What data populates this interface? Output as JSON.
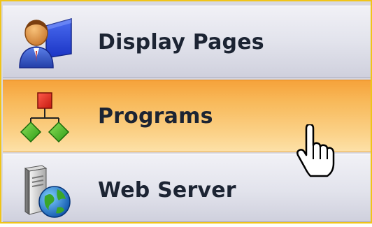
{
  "nav": {
    "items": [
      {
        "label": "Display Pages",
        "icon": "user-display-icon",
        "state": "normal"
      },
      {
        "label": "Programs",
        "icon": "program-tree-icon",
        "state": "hover"
      },
      {
        "label": "Web Server",
        "icon": "web-server-icon",
        "state": "normal"
      }
    ]
  },
  "pointer": {
    "icon": "hand-pointer-cursor-icon"
  },
  "colors": {
    "frame_border": "#f0c419",
    "hover_top": "#f6a23a",
    "hover_bottom": "#fde1a8",
    "item_top": "#f1f1f6",
    "item_bottom": "#cfd0dd",
    "label_text": "#1c2433"
  }
}
